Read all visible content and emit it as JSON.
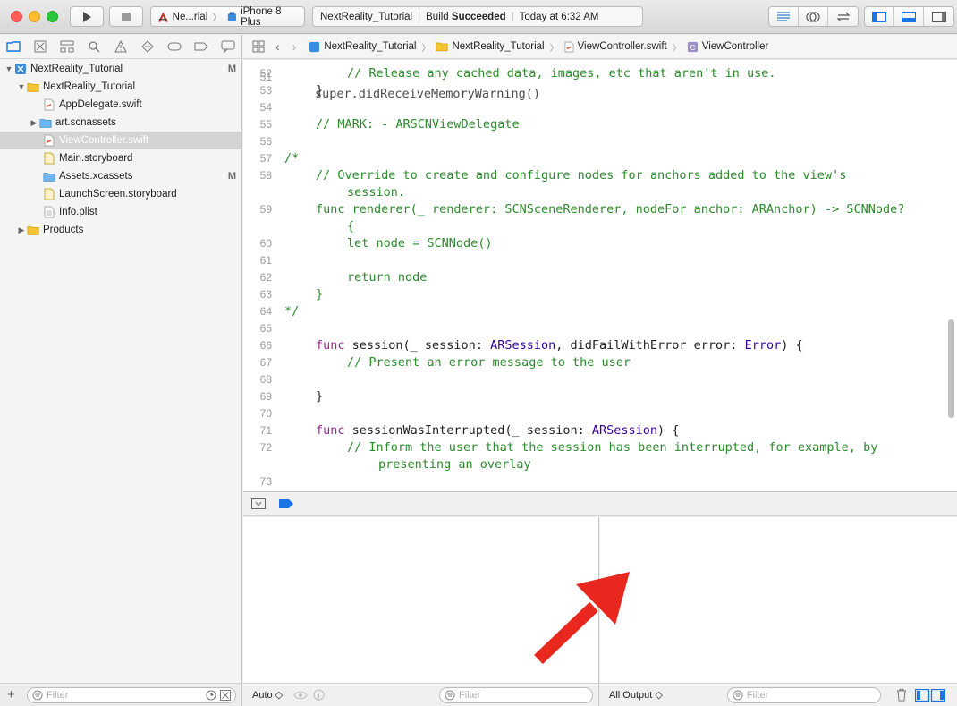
{
  "toolbar": {
    "scheme_target": "Ne...rial",
    "scheme_device": "iPhone 8 Plus",
    "status_project": "NextReality_Tutorial",
    "status_prefix": "Build",
    "status_result": "Succeeded",
    "status_time": "Today at 6:32 AM"
  },
  "navigator": {
    "tree": [
      {
        "label": "NextReality_Tutorial",
        "badge": "M"
      },
      {
        "label": "NextReality_Tutorial",
        "badge": ""
      },
      {
        "label": "AppDelegate.swift",
        "badge": ""
      },
      {
        "label": "art.scnassets",
        "badge": ""
      },
      {
        "label": "ViewController.swift",
        "badge": ""
      },
      {
        "label": "Main.storyboard",
        "badge": ""
      },
      {
        "label": "Assets.xcassets",
        "badge": "M"
      },
      {
        "label": "LaunchScreen.storyboard",
        "badge": ""
      },
      {
        "label": "Info.plist",
        "badge": ""
      },
      {
        "label": "Products",
        "badge": ""
      }
    ],
    "filter_placeholder": "Filter"
  },
  "jumpbar": {
    "crumbs": [
      "NextReality_Tutorial",
      "NextReality_Tutorial",
      "ViewController.swift",
      "ViewController"
    ]
  },
  "editor": {
    "lines": [
      {
        "n": "52",
        "indent": 2,
        "text": "// Release any cached data, images, etc that aren't in use.",
        "cls": "c-com"
      },
      {
        "n": "53",
        "indent": 1,
        "text": "}",
        "cls": "c-plain"
      },
      {
        "n": "54",
        "indent": 0,
        "text": "",
        "cls": "c-plain"
      },
      {
        "n": "55",
        "indent": 1,
        "text": "// MARK: - ARSCNViewDelegate",
        "cls": "c-com"
      },
      {
        "n": "56",
        "indent": 0,
        "text": "",
        "cls": "c-plain"
      },
      {
        "n": "57",
        "indent": 0,
        "text": "/*",
        "cls": "c-com"
      },
      {
        "n": "58",
        "indent": 1,
        "text": "// Override to create and configure nodes for anchors added to the view's",
        "cls": "c-com"
      },
      {
        "n": "",
        "indent": 2,
        "text": "session.",
        "cls": "c-com"
      },
      {
        "n": "59",
        "indent": 1,
        "text": "func renderer(_ renderer: SCNSceneRenderer, nodeFor anchor: ARAnchor) -> SCNNode?",
        "cls": "c-com"
      },
      {
        "n": "",
        "indent": 2,
        "text": "{",
        "cls": "c-com"
      },
      {
        "n": "60",
        "indent": 2,
        "text": "let node = SCNNode()",
        "cls": "c-com"
      },
      {
        "n": "61",
        "indent": 0,
        "text": "",
        "cls": "c-com"
      },
      {
        "n": "62",
        "indent": 2,
        "text": "return node",
        "cls": "c-com"
      },
      {
        "n": "63",
        "indent": 1,
        "text": "}",
        "cls": "c-com"
      },
      {
        "n": "64",
        "indent": 0,
        "text": "*/",
        "cls": "c-com"
      },
      {
        "n": "65",
        "indent": 0,
        "text": "",
        "cls": "c-plain"
      },
      {
        "n": "66",
        "indent": 1,
        "tokens": [
          [
            "func",
            "c-kw"
          ],
          [
            " session(_ session: ",
            "c-plain"
          ],
          [
            "ARSession",
            "c-type"
          ],
          [
            ", didFailWithError error: ",
            "c-plain"
          ],
          [
            "Error",
            "c-type"
          ],
          [
            ") {",
            "c-plain"
          ]
        ]
      },
      {
        "n": "67",
        "indent": 2,
        "text": "// Present an error message to the user",
        "cls": "c-com"
      },
      {
        "n": "68",
        "indent": 0,
        "text": "",
        "cls": "c-plain"
      },
      {
        "n": "69",
        "indent": 1,
        "text": "}",
        "cls": "c-plain"
      },
      {
        "n": "70",
        "indent": 0,
        "text": "",
        "cls": "c-plain"
      },
      {
        "n": "71",
        "indent": 1,
        "tokens": [
          [
            "func",
            "c-kw"
          ],
          [
            " sessionWasInterrupted(_ session: ",
            "c-plain"
          ],
          [
            "ARSession",
            "c-type"
          ],
          [
            ") {",
            "c-plain"
          ]
        ]
      },
      {
        "n": "72",
        "indent": 2,
        "text": "// Inform the user that the session has been interrupted, for example, by",
        "cls": "c-com"
      },
      {
        "n": "",
        "indent": 3,
        "text": "presenting an overlay",
        "cls": "c-com"
      },
      {
        "n": "73",
        "indent": 0,
        "text": "",
        "cls": "c-plain"
      }
    ]
  },
  "debug": {
    "auto_label": "Auto ◇",
    "filter_placeholder": "Filter",
    "output_label": "All Output ◇"
  },
  "colors": {
    "comment": "#2c8a2c",
    "keyword": "#9b2393",
    "type": "#3900a0",
    "arrow": "#e8281f",
    "accent": "#1a74e8"
  }
}
